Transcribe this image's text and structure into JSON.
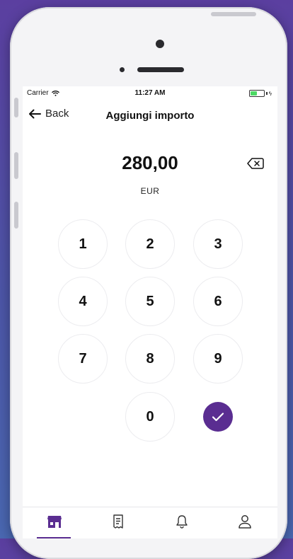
{
  "status_bar": {
    "carrier": "Carrier",
    "time": "11:27 AM",
    "battery_level": 0.55
  },
  "nav": {
    "back_label": "Back",
    "title": "Aggiungi importo"
  },
  "amount": {
    "value": "280,00",
    "currency": "EUR"
  },
  "keypad": {
    "keys": [
      "1",
      "2",
      "3",
      "4",
      "5",
      "6",
      "7",
      "8",
      "9",
      "0"
    ]
  },
  "icons": {
    "back": "arrow-left-icon",
    "delete": "backspace-icon",
    "confirm": "checkmark-icon",
    "tabs": [
      "store-icon",
      "receipt-icon",
      "bell-icon",
      "user-icon"
    ]
  },
  "colors": {
    "accent": "#5a2d91",
    "key_border": "#ececef",
    "battery": "#4cd964"
  }
}
